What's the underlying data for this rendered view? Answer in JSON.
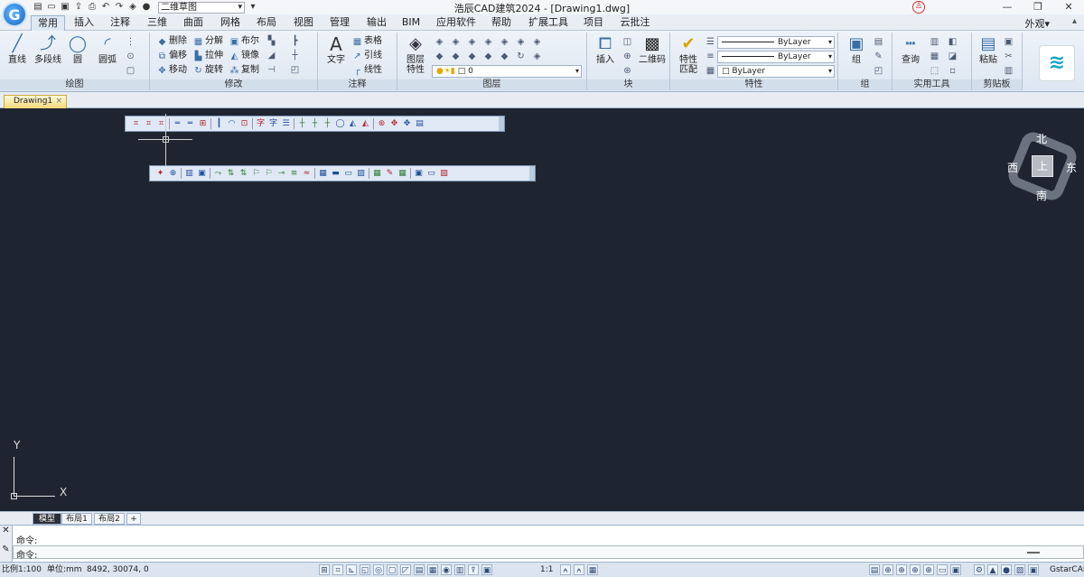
{
  "titlebar": {
    "title": "浩辰CAD建筑2024 - [Drawing1.dwg]",
    "workspace": "二维草图",
    "qat_icons": [
      "new-icon",
      "open-icon",
      "save-icon",
      "saveas-icon",
      "print-icon",
      "undo-icon",
      "redo-icon",
      "layers-icon",
      "comment-icon"
    ],
    "window_controls": [
      "—",
      "❐",
      "✕"
    ],
    "logo_letter": "G"
  },
  "tabs": {
    "items": [
      "常用",
      "插入",
      "注释",
      "三维",
      "曲面",
      "网格",
      "布局",
      "视图",
      "管理",
      "输出",
      "BIM",
      "应用软件",
      "帮助",
      "扩展工具",
      "项目",
      "云批注"
    ],
    "active": "常用",
    "appearance": "外观",
    "appearance_arrow": "▾",
    "extra": "▴"
  },
  "ribbon": {
    "draw": {
      "label": "绘图",
      "line": "直线",
      "polyline": "多段线",
      "circle": "圆",
      "arc": "圆弧"
    },
    "modify": {
      "label": "修改",
      "delete": "删除",
      "explode": "分解",
      "boolean": "布尔",
      "offset": "偏移",
      "stretch": "拉伸",
      "mirror": "镜像",
      "move": "移动",
      "rotate": "旋转",
      "copy": "复制"
    },
    "annotation": {
      "label": "注释",
      "text": "文字",
      "table": "表格",
      "leader": "引线",
      "linetype": "线性"
    },
    "layer": {
      "label": "图层",
      "properties_line1": "图层",
      "properties_line2": "特性",
      "current": "0"
    },
    "block": {
      "label": "块",
      "insert": "插入",
      "qrcode": "二维码"
    },
    "properties": {
      "label": "特性",
      "match_line1": "特性",
      "match_line2": "匹配",
      "linetype": "ByLayer",
      "lineweight": "ByLayer",
      "color": "ByLayer"
    },
    "group": {
      "label": "组",
      "group": "组"
    },
    "utilities": {
      "label": "实用工具",
      "query": "查询"
    },
    "clipboard": {
      "label": "剪贴板",
      "paste": "粘贴"
    }
  },
  "document": {
    "tab": "Drawing1",
    "close": "×"
  },
  "viewcube": {
    "north": "北",
    "south": "南",
    "east": "东",
    "west": "西",
    "face": "上"
  },
  "ucs": {
    "x": "X",
    "y": "Y"
  },
  "layout_tabs": {
    "model": "模型",
    "layout1": "布局1",
    "layout2": "布局2",
    "add": "+"
  },
  "command": {
    "line1": "命令:",
    "line2": "命令:"
  },
  "status": {
    "scale": "比例1:100",
    "unit": "单位:mm",
    "coords": "8492, 30074, 0",
    "annotation_scale": "1:1",
    "brand": "GstarCAD"
  }
}
